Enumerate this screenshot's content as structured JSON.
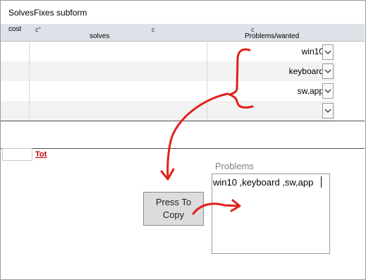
{
  "form": {
    "title": "SolvesFixes subform"
  },
  "header": {
    "cost": "cost",
    "c_deg": "c°",
    "solves": "solves",
    "c_mid": "c",
    "c_right": "c",
    "problems": "Problems/wanted"
  },
  "rows": [
    {
      "value": "win10"
    },
    {
      "value": "keyboard"
    },
    {
      "value": "sw,app"
    },
    {
      "value": ""
    }
  ],
  "footer": {
    "tot_label": "Tot"
  },
  "problems_panel": {
    "label": "Problems",
    "text": "win10 ,keyboard ,sw,app"
  },
  "button": {
    "label": "Press To Copy"
  },
  "colors": {
    "annotation": "#e0201a",
    "header_bg": "#dde1e8",
    "tot_color": "#c00000"
  }
}
